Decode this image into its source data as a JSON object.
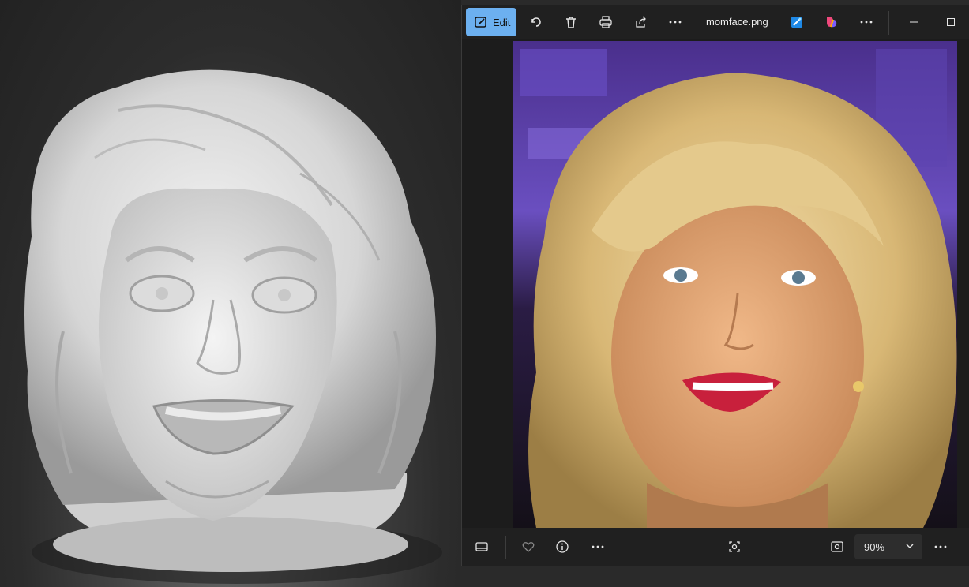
{
  "viewport": {
    "description_icon": "3d-bust-model"
  },
  "toolbar": {
    "edit_label": "Edit",
    "filename": "momface.png",
    "icons": [
      "edit-icon",
      "rotate-icon",
      "delete-icon",
      "print-icon",
      "share-icon",
      "more-icon",
      "photo-edit-app-icon",
      "copilot-icon",
      "more-icon",
      "minimize-icon",
      "maximize-icon"
    ]
  },
  "bottombar": {
    "zoom_value": "90%",
    "icons": [
      "filmstrip-icon",
      "favorite-icon",
      "info-icon",
      "more-icon",
      "fit-icon",
      "actual-size-icon",
      "chevron-down-icon",
      "more-icon"
    ]
  },
  "colors": {
    "accent": "#6cb0f0",
    "background": "#202020"
  }
}
